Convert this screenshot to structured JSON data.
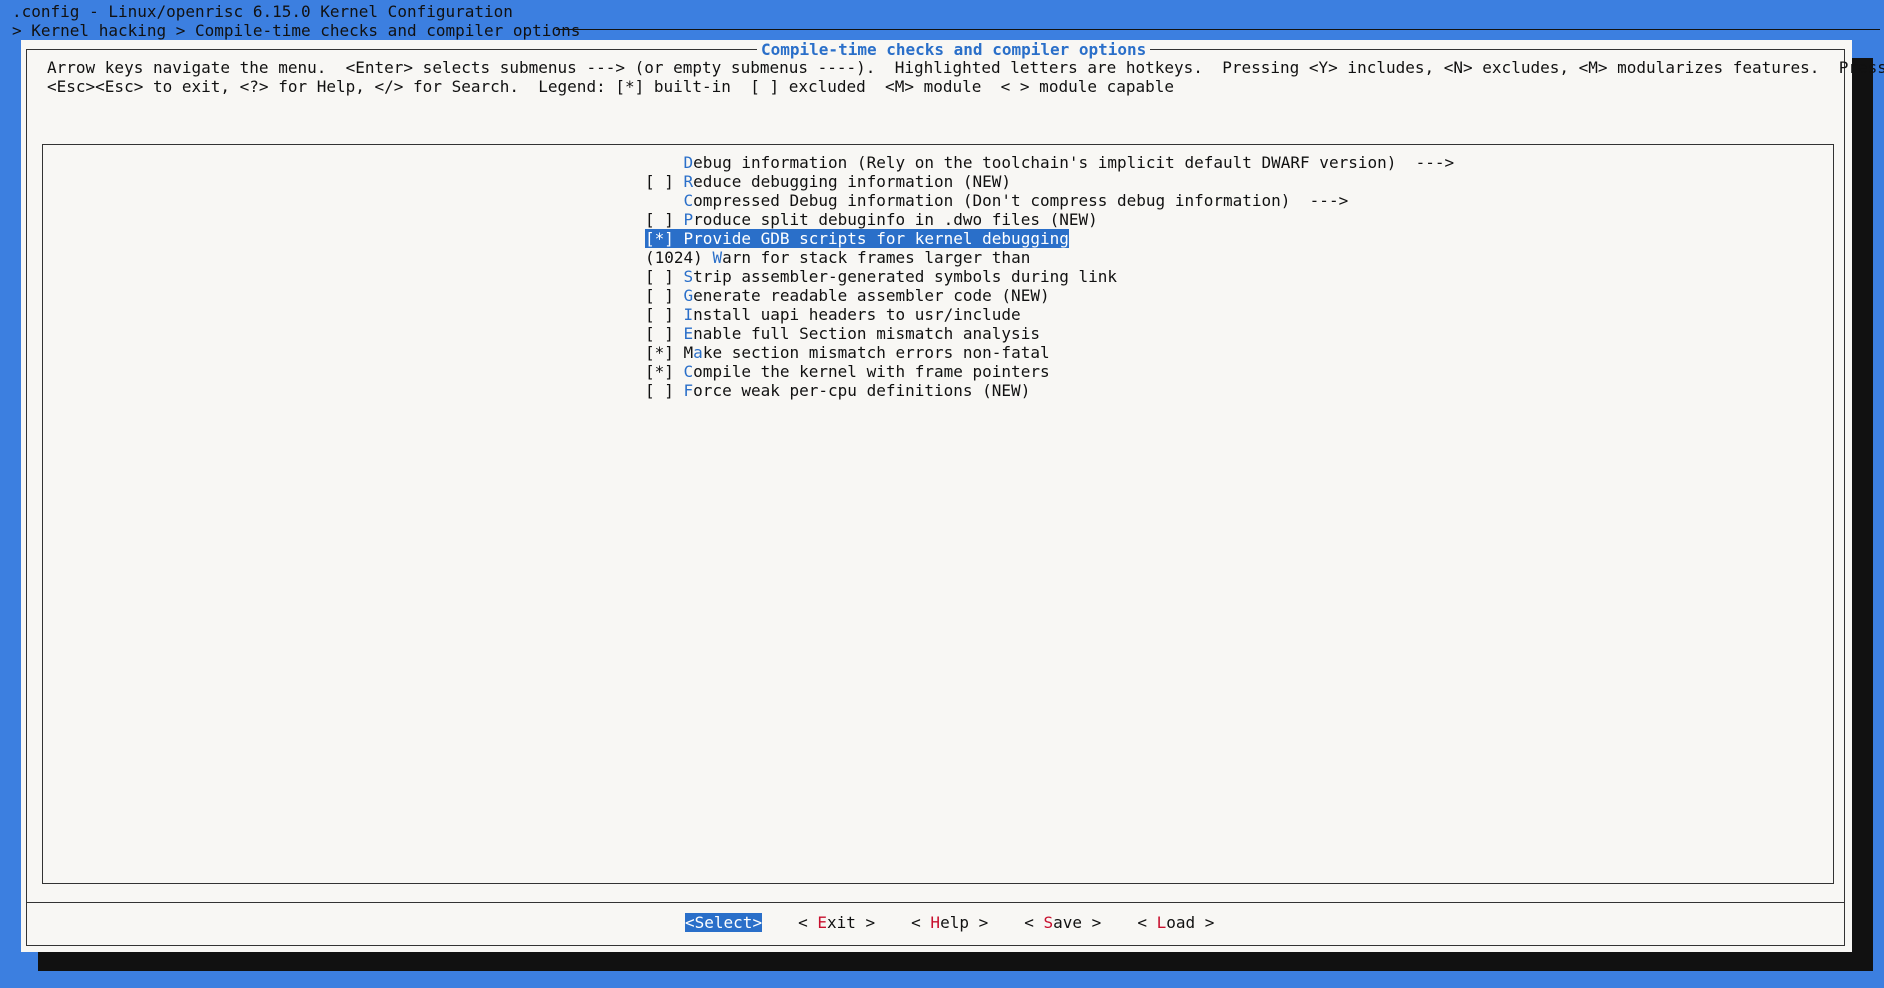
{
  "terminal": {
    "title_line": ".config - Linux/openrisc 6.15.0 Kernel Configuration",
    "breadcrumb": "> Kernel hacking > Compile-time checks and compiler options"
  },
  "dialog": {
    "title": "Compile-time checks and compiler options",
    "instructions": [
      "Arrow keys navigate the menu.  <Enter> selects submenus ---> (or empty submenus ----).  Highlighted letters are hotkeys.  Pressing <Y> includes, <N> excludes, <M> modularizes features.  Press",
      "<Esc><Esc> to exit, <?> for Help, </> for Search.  Legend: [*] built-in  [ ] excluded  <M> module  < > module capable"
    ]
  },
  "menu": {
    "items": [
      {
        "prefix": "    ",
        "hotkey": "D",
        "rest": "ebug information (Rely on the toolchain's implicit default DWARF version)  --->"
      },
      {
        "prefix": "[ ] ",
        "hotkey": "R",
        "rest": "educe debugging information (NEW)"
      },
      {
        "prefix": "    ",
        "hotkey": "C",
        "rest": "ompressed Debug information (Don't compress debug information)  --->"
      },
      {
        "prefix": "[ ] ",
        "hotkey": "P",
        "rest": "roduce split debuginfo in .dwo files (NEW)"
      },
      {
        "prefix": "[*] ",
        "hotkey": "P",
        "rest": "rovide GDB scripts for kernel debugging"
      },
      {
        "prefix": "(1024) ",
        "hotkey": "W",
        "rest": "arn for stack frames larger than"
      },
      {
        "prefix": "[ ] ",
        "hotkey": "S",
        "rest": "trip assembler-generated symbols during link"
      },
      {
        "prefix": "[ ] ",
        "hotkey": "G",
        "rest": "enerate readable assembler code (NEW)"
      },
      {
        "prefix": "[ ] ",
        "hotkey": "I",
        "rest": "nstall uapi headers to usr/include"
      },
      {
        "prefix": "[ ] ",
        "hotkey": "E",
        "rest": "nable full Section mismatch analysis"
      },
      {
        "prefix": "[*] M",
        "hotkey": "a",
        "rest": "ke section mismatch errors non-fatal"
      },
      {
        "prefix": "[*] ",
        "hotkey": "C",
        "rest": "ompile the kernel with frame pointers"
      },
      {
        "prefix": "[ ] ",
        "hotkey": "F",
        "rest": "orce weak per-cpu definitions (NEW)"
      }
    ]
  },
  "buttons": {
    "select": {
      "pre": "<",
      "hk": "",
      "rest": "Select>"
    },
    "exit": {
      "pre": "< ",
      "hk": "E",
      "rest": "xit >"
    },
    "help": {
      "pre": "< ",
      "hk": "H",
      "rest": "elp >"
    },
    "save": {
      "pre": "< ",
      "hk": "S",
      "rest": "ave >"
    },
    "load": {
      "pre": "< ",
      "hk": "L",
      "rest": "oad >"
    }
  },
  "colors": {
    "background": "#3c7fe0",
    "dialog": "#f8f7f4",
    "accent": "#2a6fc9",
    "button_hotkey": "#c8102e"
  }
}
